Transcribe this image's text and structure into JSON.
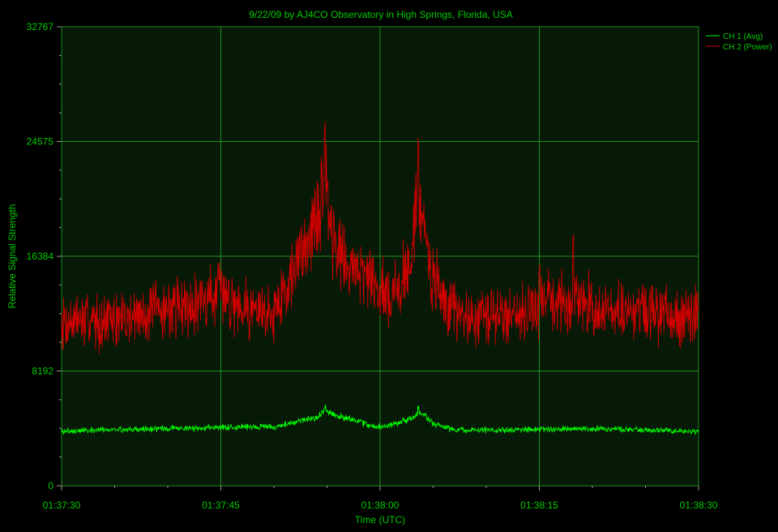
{
  "chart_data": {
    "type": "line",
    "title": "9/22/09  by  AJ4CO Observatory  in  High Springs, Florida, USA",
    "xlabel": "Time (UTC)",
    "ylabel": "Relative Signal Strength",
    "ylim": [
      0,
      32767
    ],
    "xlim_seconds": [
      0,
      60
    ],
    "y_ticks": [
      0,
      8192,
      16384,
      24575,
      32767
    ],
    "x_ticks": [
      {
        "t": 0,
        "label": "01:37:30"
      },
      {
        "t": 15,
        "label": "01:37:45"
      },
      {
        "t": 30,
        "label": "01:38:00"
      },
      {
        "t": 45,
        "label": "01:38:15"
      },
      {
        "t": 60,
        "label": "01:38:30"
      }
    ],
    "grid": true,
    "legend_position": "top-right",
    "colors": {
      "background": "#000000",
      "plot_area": "#071a07",
      "grid": "#1f8f1f",
      "text": "#00cc00",
      "ch1": "#00ff00",
      "ch2": "#cc0000"
    },
    "series": [
      {
        "name": "CH 1 (Avg)",
        "color": "#00ff00",
        "envelope": {
          "t": [
            0,
            10,
            18,
            20,
            24,
            25,
            26,
            28,
            29,
            30,
            32,
            33,
            34,
            35,
            37,
            45,
            48,
            60
          ],
          "y": [
            3900,
            4100,
            4200,
            4200,
            4900,
            5300,
            5000,
            4600,
            4300,
            4200,
            4500,
            4900,
            5200,
            4400,
            4000,
            4000,
            4100,
            3900
          ]
        },
        "peaks": [
          {
            "t": 24.8,
            "y": 5900
          },
          {
            "t": 33.6,
            "y": 5900
          }
        ]
      },
      {
        "name": "CH 2 (Power)",
        "color": "#cc0000",
        "envelope": {
          "t": [
            0,
            5,
            8,
            12,
            15,
            17,
            19,
            20,
            22,
            23,
            24,
            24.8,
            25.5,
            26,
            27,
            28,
            29,
            30,
            31,
            32,
            33,
            33.6,
            34.5,
            36,
            38,
            42,
            45,
            46,
            48,
            49,
            51,
            55,
            60
          ],
          "y": [
            11800,
            11800,
            12300,
            13000,
            13800,
            13000,
            12300,
            12500,
            15500,
            17800,
            18500,
            22500,
            18000,
            17200,
            15800,
            15500,
            14800,
            13800,
            13500,
            14200,
            16800,
            20500,
            16000,
            13000,
            12000,
            12200,
            12700,
            13500,
            12500,
            13400,
            12300,
            12300,
            12000
          ]
        },
        "peaks": [
          {
            "t": 24.8,
            "y": 25500
          },
          {
            "t": 33.6,
            "y": 26000
          },
          {
            "t": 48.2,
            "y": 18000
          },
          {
            "t": 45,
            "y": 16000
          }
        ]
      }
    ]
  }
}
